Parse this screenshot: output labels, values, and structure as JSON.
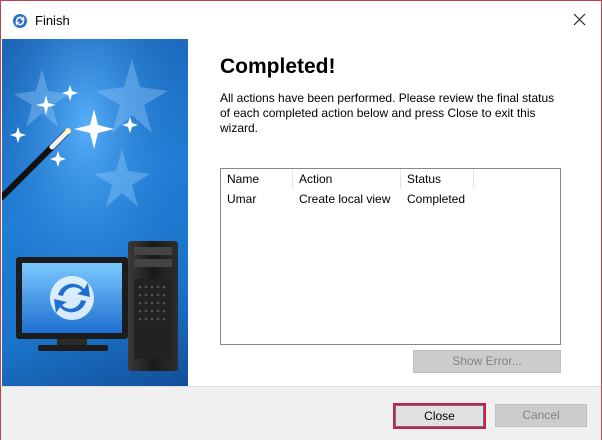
{
  "window": {
    "title": "Finish",
    "close_symbol": "✕"
  },
  "wizard": {
    "heading": "Completed!",
    "description": "All actions have been performed. Please review the final status of each completed action below and press Close to exit this wizard."
  },
  "results_table": {
    "columns": [
      "Name",
      "Action",
      "Status"
    ],
    "rows": [
      [
        "Umar",
        "Create local view",
        "Completed"
      ]
    ]
  },
  "buttons": {
    "show_error": "Show Error...",
    "close": "Close",
    "cancel": "Cancel"
  },
  "colors": {
    "banner_blue": "#1f7ed6",
    "default_button_border": "#d41d3a",
    "disabled_text": "#838383"
  },
  "icons": [
    "app-icon",
    "close-icon",
    "magic-wand-icon",
    "computer-sync-icon",
    "pc-tower-icon",
    "star-icon"
  ]
}
